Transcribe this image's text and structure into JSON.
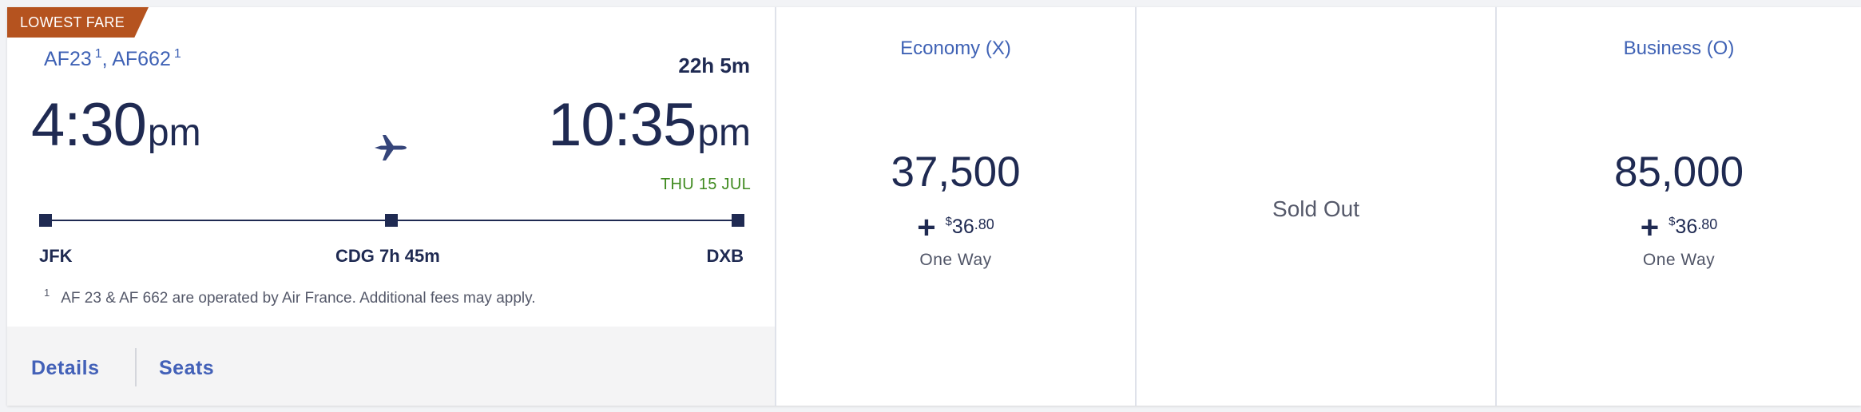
{
  "badge": "LOWEST FARE",
  "flight": {
    "number_1": "AF23",
    "number_1_note": "1",
    "number_2": "AF662",
    "number_2_note": "1",
    "separator": ",",
    "duration": "22h 5m",
    "departure": {
      "time": "4:30",
      "ampm": "pm"
    },
    "arrival": {
      "time": "10:35",
      "ampm": "pm",
      "date": "THU 15 JUL"
    },
    "stops": [
      {
        "code": "JFK"
      },
      {
        "code": "CDG 7h 45m"
      },
      {
        "code": "DXB"
      }
    ],
    "footnote_mark": "1",
    "footnote": "AF 23 & AF 662 are operated by Air France. Additional fees may apply."
  },
  "footer": {
    "details": "Details",
    "seats": "Seats"
  },
  "fares": [
    {
      "cabin": "Economy (X)",
      "miles": "37,500",
      "plus": "+",
      "currency": "$",
      "fee_int": "36",
      "fee_cents": ".80",
      "trip": "One Way"
    },
    {
      "status": "Sold Out"
    },
    {
      "cabin": "Business (O)",
      "miles": "85,000",
      "plus": "+",
      "currency": "$",
      "fee_int": "36",
      "fee_cents": ".80",
      "trip": "One Way"
    }
  ],
  "colors": {
    "navy": "#1f2a52",
    "link_blue": "#3f62b5",
    "badge_orange": "#b5531f",
    "date_green": "#3f8a1f"
  },
  "icons": {
    "route": "airplane-icon"
  }
}
